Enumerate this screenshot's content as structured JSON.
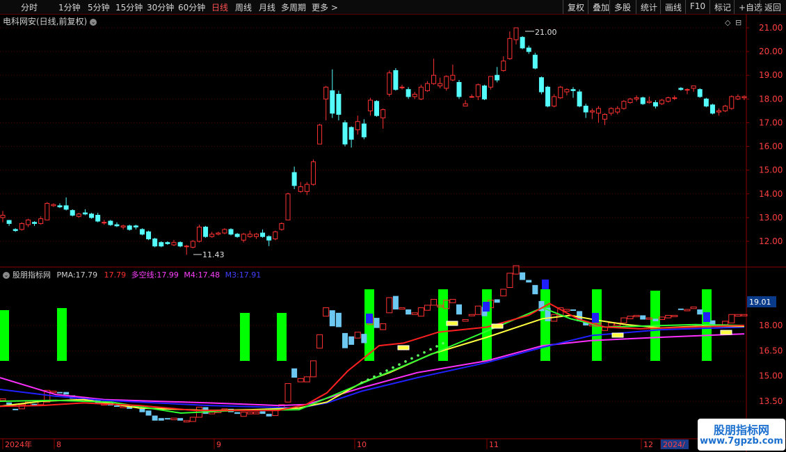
{
  "toolbar": {
    "periods": [
      "分时",
      "1分钟",
      "5分钟",
      "15分钟",
      "30分钟",
      "60分钟",
      "日线",
      "周线",
      "月线",
      "多周期",
      "更多 >"
    ],
    "active_period": "日线",
    "right_buttons": [
      "复权",
      "叠加",
      "多股",
      "统计",
      "画线",
      "F10",
      "标记",
      "+自选",
      "返回"
    ]
  },
  "main_chart": {
    "title": "电科网安(日线,前复权)",
    "menu_glyph": "⌄",
    "corner_icons": [
      "◇",
      "⊟"
    ],
    "price_ticks": [
      "21.00",
      "20.00",
      "19.00",
      "18.00",
      "17.00",
      "16.00",
      "15.00",
      "14.00",
      "13.00",
      "12.00"
    ],
    "high_label": "21.00",
    "low_label": "11.43"
  },
  "indicator": {
    "name": "股朋指标网",
    "pma_label": "PMA:",
    "pma_value": "17.79",
    "second_value": "17.79",
    "dk_label": "多空线:",
    "dk_value": "17.99",
    "m4_label": "M4:",
    "m4_value": "17.48",
    "m3_label": "M3:",
    "m3_value": "17.91",
    "ticks": [
      "18.00",
      "16.50",
      "15.00",
      "13.50"
    ],
    "current_tag": "19.01"
  },
  "date_axis": [
    "2024年",
    "8",
    "9",
    "10",
    "11",
    "12",
    "2024/"
  ],
  "watermark": {
    "line1": "股朋指标网",
    "line2": "www.7gpzb.com"
  },
  "colors": {
    "up": "#ff3232",
    "down": "#54fcfc",
    "bg": "#000000",
    "grid": "#5a0000",
    "signal": "#00ff00",
    "pma": "#ff2020",
    "dk_line": "#ffff40",
    "m4": "#ff30ff",
    "m3": "#2020ff",
    "green_line": "#30ff30"
  },
  "chart_data": {
    "type": "candlestick",
    "title": "电科网安(日线,前复权)",
    "ylim": [
      11.4,
      21.6
    ],
    "y_ticks": [
      12,
      13,
      14,
      15,
      16,
      17,
      18,
      19,
      20,
      21
    ],
    "annotations": [
      {
        "text": "21.00",
        "value": 21.0
      },
      {
        "text": "11.43",
        "value": 11.43
      }
    ],
    "candles": [
      [
        13.0,
        13.1,
        13.28,
        12.8
      ],
      [
        12.88,
        12.75,
        12.9,
        12.65
      ],
      [
        12.5,
        12.45,
        12.55,
        12.4
      ],
      [
        12.5,
        12.75,
        12.8,
        12.45
      ],
      [
        12.7,
        12.9,
        12.95,
        12.6
      ],
      [
        12.8,
        12.75,
        12.85,
        12.65
      ],
      [
        12.75,
        12.95,
        13.05,
        12.7
      ],
      [
        12.9,
        13.6,
        13.65,
        12.9
      ],
      [
        13.5,
        13.55,
        13.6,
        13.45
      ],
      [
        13.5,
        13.45,
        13.6,
        13.4
      ],
      [
        13.5,
        13.35,
        13.85,
        13.3
      ],
      [
        13.3,
        13.1,
        13.35,
        13.05
      ],
      [
        13.05,
        13.15,
        13.2,
        13.0
      ],
      [
        13.2,
        13.15,
        13.35,
        13.1
      ],
      [
        13.15,
        13.0,
        13.2,
        12.95
      ],
      [
        13.1,
        12.85,
        13.2,
        12.8
      ],
      [
        12.8,
        12.8,
        12.9,
        12.7
      ],
      [
        12.85,
        12.7,
        12.9,
        12.65
      ],
      [
        12.7,
        12.65,
        12.8,
        12.6
      ],
      [
        12.6,
        12.65,
        12.7,
        12.5
      ],
      [
        12.65,
        12.5,
        12.7,
        12.45
      ],
      [
        12.65,
        12.6,
        12.7,
        12.5
      ],
      [
        12.5,
        12.3,
        12.55,
        12.25
      ],
      [
        12.4,
        12.1,
        12.45,
        12.05
      ],
      [
        12.1,
        11.8,
        12.15,
        11.75
      ],
      [
        11.95,
        11.8,
        12.0,
        11.75
      ],
      [
        11.95,
        11.9,
        12.0,
        11.85
      ],
      [
        11.85,
        11.95,
        12.05,
        11.8
      ],
      [
        11.95,
        11.8,
        12.0,
        11.75
      ],
      [
        11.8,
        11.8,
        11.85,
        11.43
      ],
      [
        11.75,
        12.0,
        12.05,
        11.7
      ],
      [
        12.0,
        12.6,
        12.7,
        11.95
      ],
      [
        12.6,
        12.2,
        12.65,
        12.15
      ],
      [
        12.2,
        12.3,
        12.4,
        12.15
      ],
      [
        12.3,
        12.35,
        12.4,
        12.25
      ],
      [
        12.35,
        12.5,
        12.55,
        12.3
      ],
      [
        12.5,
        12.3,
        12.55,
        12.25
      ],
      [
        12.3,
        12.2,
        12.35,
        12.15
      ],
      [
        12.05,
        12.3,
        12.35,
        11.95
      ],
      [
        12.2,
        12.3,
        12.45,
        12.15
      ],
      [
        12.2,
        12.3,
        12.35,
        12.1
      ],
      [
        12.35,
        12.2,
        12.5,
        12.15
      ],
      [
        12.2,
        12.05,
        12.25,
        11.8
      ],
      [
        12.1,
        12.4,
        12.45,
        12.05
      ],
      [
        12.5,
        12.75,
        12.8,
        12.45
      ],
      [
        12.9,
        14.0,
        14.05,
        12.9
      ],
      [
        14.9,
        14.35,
        15.15,
        14.2
      ],
      [
        14.1,
        14.3,
        14.5,
        14.05
      ],
      [
        14.1,
        14.4,
        14.5,
        13.95
      ],
      [
        14.4,
        15.35,
        15.45,
        14.35
      ],
      [
        16.1,
        16.9,
        16.95,
        16.1
      ],
      [
        18.0,
        18.5,
        18.55,
        17.1
      ],
      [
        18.35,
        17.4,
        19.25,
        17.2
      ],
      [
        18.2,
        17.35,
        18.35,
        17.1
      ],
      [
        17.0,
        16.1,
        17.1,
        16.0
      ],
      [
        16.8,
        16.3,
        16.85,
        15.95
      ],
      [
        16.7,
        17.05,
        17.3,
        16.5
      ],
      [
        16.95,
        16.4,
        17.15,
        16.3
      ],
      [
        17.5,
        17.95,
        18.05,
        17.3
      ],
      [
        17.9,
        17.3,
        17.95,
        17.25
      ],
      [
        17.2,
        17.55,
        17.6,
        16.75
      ],
      [
        18.2,
        19.1,
        19.2,
        18.1
      ],
      [
        19.2,
        18.4,
        19.3,
        18.35
      ],
      [
        18.5,
        18.5,
        18.6,
        18.4
      ],
      [
        18.4,
        18.1,
        18.5,
        18.0
      ],
      [
        18.1,
        18.2,
        18.3,
        18.0
      ],
      [
        18.0,
        18.5,
        18.6,
        17.95
      ],
      [
        18.35,
        18.65,
        18.75,
        18.3
      ],
      [
        18.65,
        19.0,
        19.7,
        18.6
      ],
      [
        18.55,
        18.65,
        18.9,
        18.45
      ],
      [
        18.45,
        18.95,
        19.0,
        18.35
      ],
      [
        18.8,
        19.0,
        19.45,
        18.75
      ],
      [
        18.7,
        18.1,
        18.8,
        18.0
      ],
      [
        17.7,
        17.8,
        17.95,
        17.7
      ],
      [
        18.1,
        18.1,
        18.2,
        18.05
      ],
      [
        18.1,
        18.6,
        18.65,
        17.95
      ],
      [
        18.55,
        18.0,
        18.6,
        17.95
      ],
      [
        18.5,
        18.95,
        18.95,
        18.4
      ],
      [
        19.0,
        18.8,
        19.35,
        18.7
      ],
      [
        19.2,
        19.6,
        19.8,
        19.15
      ],
      [
        19.7,
        20.55,
        20.85,
        19.65
      ],
      [
        20.5,
        21.0,
        21.0,
        20.3
      ],
      [
        20.6,
        20.15,
        20.65,
        20.1
      ],
      [
        20.15,
        20.0,
        20.25,
        19.9
      ],
      [
        19.85,
        19.3,
        19.95,
        19.25
      ],
      [
        18.9,
        18.3,
        18.95,
        18.2
      ],
      [
        18.5,
        17.7,
        18.55,
        17.65
      ],
      [
        17.7,
        18.1,
        18.2,
        17.65
      ],
      [
        18.05,
        18.5,
        18.55,
        18.0
      ],
      [
        18.3,
        18.4,
        18.45,
        18.15
      ],
      [
        18.4,
        18.35,
        18.5,
        18.05
      ],
      [
        18.3,
        17.7,
        18.4,
        17.65
      ],
      [
        17.7,
        17.45,
        17.8,
        17.2
      ],
      [
        17.45,
        17.5,
        17.6,
        17.15
      ],
      [
        17.4,
        17.6,
        17.7,
        17.0
      ],
      [
        17.15,
        17.35,
        17.4,
        16.9
      ],
      [
        17.4,
        17.6,
        17.65,
        17.3
      ],
      [
        17.45,
        17.6,
        17.7,
        17.35
      ],
      [
        17.6,
        17.9,
        17.95,
        17.55
      ],
      [
        17.85,
        18.0,
        18.05,
        17.8
      ],
      [
        18.0,
        18.05,
        18.15,
        17.9
      ],
      [
        18.05,
        17.8,
        18.1,
        17.75
      ],
      [
        17.85,
        17.9,
        18.1,
        17.8
      ],
      [
        17.85,
        17.7,
        17.95,
        17.6
      ],
      [
        17.8,
        17.95,
        18.0,
        17.75
      ],
      [
        17.9,
        18.05,
        18.1,
        17.85
      ],
      [
        18.05,
        18.05,
        18.15,
        17.95
      ],
      [
        18.45,
        18.4,
        18.5,
        18.35
      ],
      [
        18.4,
        18.4,
        18.45,
        18.2
      ],
      [
        18.45,
        18.55,
        18.55,
        18.3
      ],
      [
        18.4,
        18.1,
        18.45,
        18.05
      ],
      [
        18.0,
        17.7,
        18.05,
        17.65
      ],
      [
        17.75,
        17.4,
        17.8,
        17.35
      ],
      [
        17.45,
        17.5,
        17.6,
        17.3
      ],
      [
        17.5,
        17.7,
        17.75,
        17.45
      ],
      [
        17.6,
        18.1,
        18.15,
        17.55
      ],
      [
        18.0,
        18.1,
        18.2,
        17.95
      ],
      [
        18.05,
        18.1,
        18.15,
        17.95
      ]
    ],
    "indicator_series": {
      "ylim": [
        12.8,
        20.3
      ],
      "signal_bars": [
        {
          "date": "2024-07-22",
          "from": 16.5,
          "to": 19.0
        },
        {
          "date": "2024-07-29",
          "from": 16.5,
          "to": 19.0
        },
        {
          "date": "2024-08-21",
          "from": 16.5,
          "to": 18.3
        },
        {
          "date": "2024-08-26",
          "from": 16.5,
          "to": 18.3
        },
        {
          "date": "2024-09-30",
          "from": 16.5,
          "to": 19.8
        },
        {
          "date": "2024-10-17",
          "from": 16.5,
          "to": 19.8
        },
        {
          "date": "2024-10-24",
          "from": 16.5,
          "to": 19.8
        },
        {
          "date": "2024-11-06",
          "from": 16.5,
          "to": 19.8
        },
        {
          "date": "2024-11-13",
          "from": 16.5,
          "to": 19.8
        },
        {
          "date": "2024-11-21",
          "from": 16.5,
          "to": 19.8
        },
        {
          "date": "2024-11-28",
          "from": 16.5,
          "to": 19.8
        },
        {
          "date": "2024-12-04",
          "from": 16.5,
          "to": 19.8
        }
      ],
      "M4": [
        [
          0,
          14.9
        ],
        [
          40,
          14.4
        ],
        [
          80,
          13.9
        ],
        [
          150,
          13.6
        ],
        [
          300,
          13.4
        ],
        [
          400,
          13.25
        ],
        [
          440,
          13.3
        ],
        [
          520,
          14.3
        ],
        [
          600,
          15.2
        ],
        [
          700,
          15.9
        ],
        [
          780,
          16.8
        ],
        [
          850,
          17.1
        ],
        [
          950,
          17.3
        ],
        [
          1070,
          17.5
        ]
      ],
      "M3": [
        [
          0,
          14.2
        ],
        [
          80,
          13.8
        ],
        [
          150,
          13.55
        ],
        [
          300,
          13.25
        ],
        [
          430,
          13.1
        ],
        [
          470,
          13.4
        ],
        [
          520,
          14.1
        ],
        [
          600,
          14.9
        ],
        [
          700,
          15.8
        ],
        [
          780,
          16.7
        ],
        [
          850,
          17.4
        ],
        [
          950,
          17.75
        ],
        [
          1070,
          17.9
        ]
      ],
      "dk_line": [
        [
          0,
          13.2
        ],
        [
          60,
          13.5
        ],
        [
          120,
          13.6
        ],
        [
          200,
          13.1
        ],
        [
          300,
          12.95
        ],
        [
          360,
          13.0
        ],
        [
          430,
          13.1
        ],
        [
          470,
          13.45
        ],
        [
          520,
          14.6
        ],
        [
          560,
          15.2
        ],
        [
          620,
          16.3
        ],
        [
          700,
          17.3
        ],
        [
          780,
          18.4
        ],
        [
          820,
          18.6
        ],
        [
          860,
          18.3
        ],
        [
          900,
          18.05
        ],
        [
          950,
          17.85
        ],
        [
          1000,
          17.95
        ],
        [
          1070,
          17.95
        ]
      ],
      "PMA": [
        [
          0,
          13.2
        ],
        [
          60,
          13.25
        ],
        [
          120,
          13.4
        ],
        [
          200,
          13.25
        ],
        [
          280,
          12.95
        ],
        [
          400,
          12.95
        ],
        [
          440,
          13.3
        ],
        [
          470,
          14.0
        ],
        [
          500,
          15.3
        ],
        [
          545,
          16.8
        ],
        [
          580,
          16.95
        ],
        [
          630,
          17.6
        ],
        [
          700,
          17.9
        ],
        [
          760,
          18.6
        ],
        [
          790,
          19.3
        ],
        [
          830,
          18.4
        ],
        [
          870,
          17.9
        ],
        [
          920,
          17.8
        ],
        [
          1070,
          18.0
        ]
      ],
      "green_line": [
        [
          0,
          13.5
        ],
        [
          80,
          13.55
        ],
        [
          160,
          13.45
        ],
        [
          260,
          12.8
        ],
        [
          340,
          12.95
        ],
        [
          430,
          13.0
        ],
        [
          780,
          19.05
        ],
        [
          820,
          18.4
        ],
        [
          870,
          17.9
        ],
        [
          1000,
          18.05
        ],
        [
          1070,
          18.0
        ]
      ]
    }
  }
}
